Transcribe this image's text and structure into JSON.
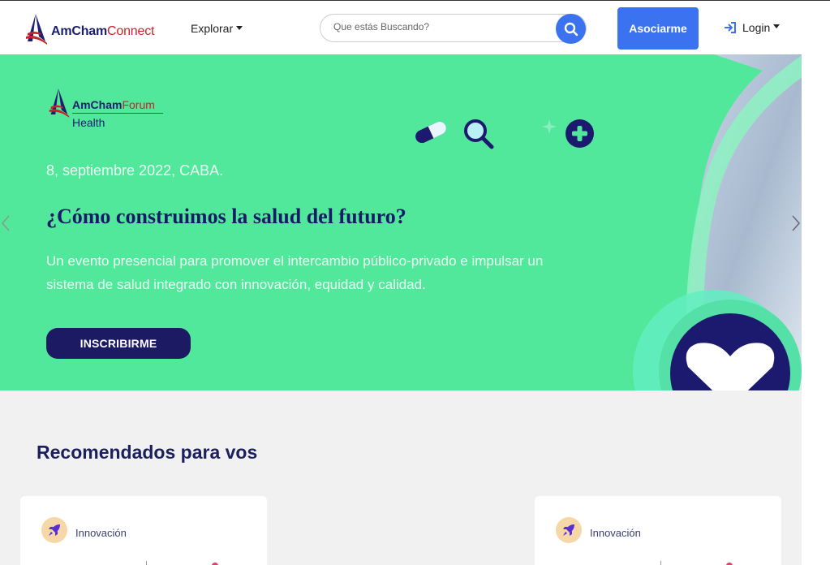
{
  "nav": {
    "logo_part1": "AmCham",
    "logo_part2": "Connect",
    "explore_label": "Explorar",
    "search_placeholder": "Que estás Buscando?",
    "join_label": "Asociarme",
    "login_label": "Login"
  },
  "hero": {
    "forum_part1": "AmCham",
    "forum_part2": "Forum",
    "forum_part3": "Health",
    "date": "8, septiembre 2022, CABA.",
    "headline": "¿Cómo construimos la salud del futuro?",
    "description": "Un evento presencial para promover el intercambio público-privado e impulsar un sistema de salud integrado con innovación, equidad y calidad.",
    "cta_label": "INSCRIBIRME",
    "background_color": "#52e89b"
  },
  "recommended": {
    "title_bold": "Recomendados",
    "title_rest": " para vos",
    "cards": [
      {
        "category": "Innovación",
        "icon": "rocket-icon"
      },
      {
        "category": "Innovación",
        "icon": "rocket-icon"
      }
    ]
  },
  "colors": {
    "primary_blue": "#3b72f0",
    "navy": "#1c1a63",
    "brand_red": "#c8232c"
  }
}
